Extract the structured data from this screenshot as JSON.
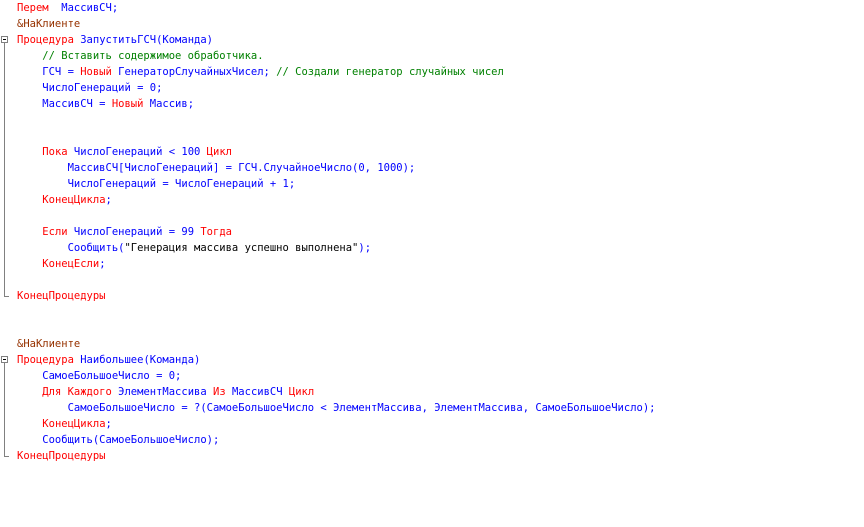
{
  "code": {
    "l1": {
      "a": "Перем",
      "b": "  МассивСЧ;"
    },
    "l2": {
      "a": "&НаКлиенте"
    },
    "l3": {
      "a": "Процедура",
      "b": " ЗапуститьГСЧ(Команда)"
    },
    "l4": {
      "a": "    // Вставить содержимое обработчика."
    },
    "l5": {
      "a": "    ГСЧ = ",
      "b": "Новый",
      "c": " ГенераторСлучайныхЧисел; ",
      "d": "// Создали генератор случайных чисел"
    },
    "l6": {
      "a": "    ЧислоГенераций = 0;"
    },
    "l7": {
      "a": "    МассивСЧ = ",
      "b": "Новый",
      "c": " Массив;"
    },
    "l8": {
      "a": "    ",
      "b": "Пока",
      "c": " ЧислоГенераций < 100 ",
      "d": "Цикл"
    },
    "l9": {
      "a": "        МассивСЧ[ЧислоГенераций] = ГСЧ.СлучайноеЧисло(0, 1000);"
    },
    "l10": {
      "a": "        ЧислоГенераций = ЧислоГенераций + 1;"
    },
    "l11": {
      "a": "    ",
      "b": "КонецЦикла",
      "c": ";"
    },
    "l12": {
      "a": "    ",
      "b": "Если",
      "c": " ЧислоГенераций = 99 ",
      "d": "Тогда"
    },
    "l13": {
      "a": "        Сообщить(",
      "b": "\"Генерация массива успешно выполнена\"",
      "c": ");"
    },
    "l14": {
      "a": "    ",
      "b": "КонецЕсли",
      "c": ";"
    },
    "l15": {
      "a": "КонецПроцедуры"
    },
    "l16": {
      "a": "&НаКлиенте"
    },
    "l17": {
      "a": "Процедура",
      "b": " Наибольшее(Команда)"
    },
    "l18": {
      "a": "    СамоеБольшоеЧисло = 0;"
    },
    "l19": {
      "a": "    ",
      "b": "Для Каждого",
      "c": " ЭлементМассива ",
      "d": "Из",
      "e": " МассивСЧ ",
      "f": "Цикл"
    },
    "l20": {
      "a": "        СамоеБольшоеЧисло = ?(СамоеБольшоеЧисло < ЭлементМассива, ЭлементМассива, СамоеБольшоеЧисло);"
    },
    "l21": {
      "a": "    ",
      "b": "КонецЦикла",
      "c": ";"
    },
    "l22": {
      "a": "    Сообщить(СамоеБольшоеЧисло);"
    },
    "l23": {
      "a": "КонецПроцедуры"
    }
  }
}
